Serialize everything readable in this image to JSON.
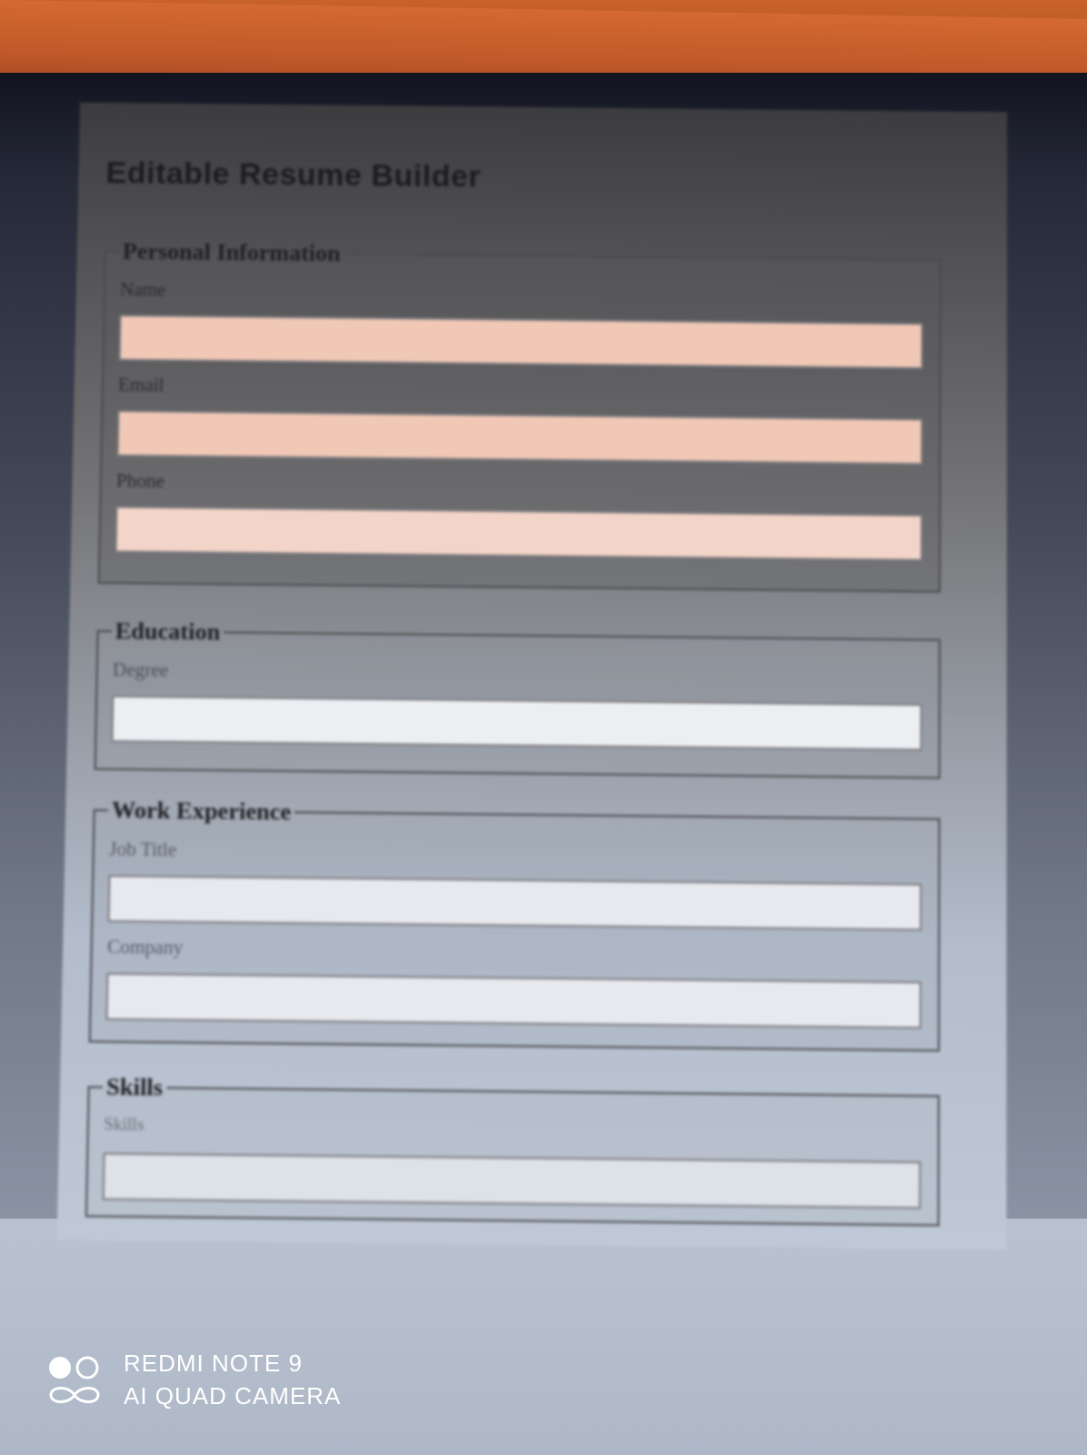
{
  "app": {
    "title": "Editable Resume Builder"
  },
  "sections": {
    "personal": {
      "legend": "Personal Information",
      "fields": [
        {
          "label": "Name",
          "value": ""
        },
        {
          "label": "Email",
          "value": ""
        },
        {
          "label": "Phone",
          "value": ""
        }
      ]
    },
    "education": {
      "legend": "Education",
      "fields": [
        {
          "label": "Degree",
          "value": ""
        }
      ]
    },
    "work": {
      "legend": "Work Experience",
      "fields": [
        {
          "label": "Job Title",
          "value": ""
        },
        {
          "label": "Company",
          "value": ""
        }
      ]
    },
    "skills": {
      "legend": "Skills",
      "fields": [
        {
          "label": "Skills",
          "value": ""
        }
      ]
    }
  },
  "watermark": {
    "line1": "REDMI NOTE 9",
    "line2": "AI QUAD CAMERA"
  },
  "colors": {
    "wall": "#c8622a",
    "input_personal": "#f1c8b6",
    "input_other": "#e7e9ee"
  }
}
